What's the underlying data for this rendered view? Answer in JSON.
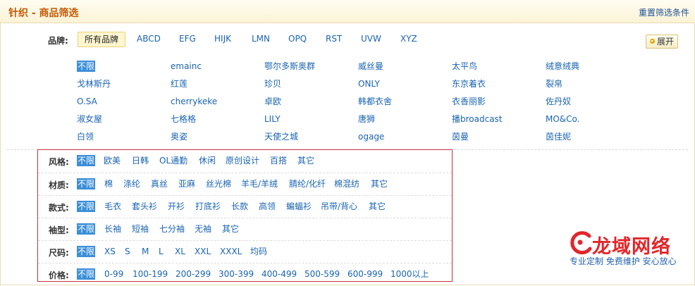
{
  "header": {
    "title": "针织 - 商品筛选",
    "reset_label": "重置筛选条件"
  },
  "brand_filter": {
    "label": "品牌:",
    "letters": [
      "所有品牌",
      "ABCD",
      "EFG",
      "HIJK",
      "LMN",
      "OPQ",
      "RST",
      "UVW",
      "XYZ"
    ],
    "active_letter_index": 0,
    "expand_label": "展开",
    "columns": [
      [
        "不限",
        "戈林斯丹",
        "O.SA",
        "淑女屋",
        "白领"
      ],
      [
        "emainc",
        "红莲",
        "cherrykeke",
        "七格格",
        "奥姿"
      ],
      [
        "鄂尔多斯奥群",
        "珍贝",
        "卓欧",
        "LILY",
        "天使之城"
      ],
      [
        "威丝曼",
        "ONLY",
        "韩都衣舍",
        "唐狮",
        "ogage"
      ],
      [
        "太平鸟",
        "东京着衣",
        "衣香丽影",
        "播broadcast",
        "茵曼"
      ],
      [
        "绒意绒典",
        "裂帛",
        "佐丹奴",
        "MO&Co.",
        "茵佳妮"
      ]
    ],
    "selected": "不限"
  },
  "filters": [
    {
      "label": "风格:",
      "options": [
        "不限",
        "欧美",
        "日韩",
        "OL通勤",
        "休闲",
        "原创设计",
        "百搭",
        "其它"
      ]
    },
    {
      "label": "材质:",
      "options": [
        "不限",
        "棉",
        "涤纶",
        "真丝",
        "亚麻",
        "丝光棉",
        "羊毛/羊绒",
        "腈纶/化纤",
        "棉混纺",
        "其它"
      ]
    },
    {
      "label": "款式:",
      "options": [
        "不限",
        "毛衣",
        "套头衫",
        "开衫",
        "打底衫",
        "长款",
        "高领",
        "蝙蝠衫",
        "吊带/背心",
        "其它"
      ]
    },
    {
      "label": "袖型:",
      "options": [
        "不限",
        "长袖",
        "短袖",
        "七分袖",
        "无袖",
        "其它"
      ]
    },
    {
      "label": "尺码:",
      "options": [
        "不限",
        "XS",
        "S",
        "M",
        "L",
        "XL",
        "XXL",
        "XXXL",
        "均码"
      ]
    },
    {
      "label": "价格:",
      "options": [
        "不限",
        "0-99",
        "100-199",
        "200-299",
        "300-399",
        "400-499",
        "500-599",
        "600-999",
        "1000以上"
      ]
    }
  ],
  "watermark": {
    "name": "龙域网络",
    "slogan": "专业定制 免费维护 安心放心"
  },
  "colors": {
    "accent": "#c35a05",
    "link": "#1a64b1",
    "selected_bg": "#3b8fd8",
    "highlight_border": "#c7313b",
    "logo_red": "#e2262b"
  }
}
